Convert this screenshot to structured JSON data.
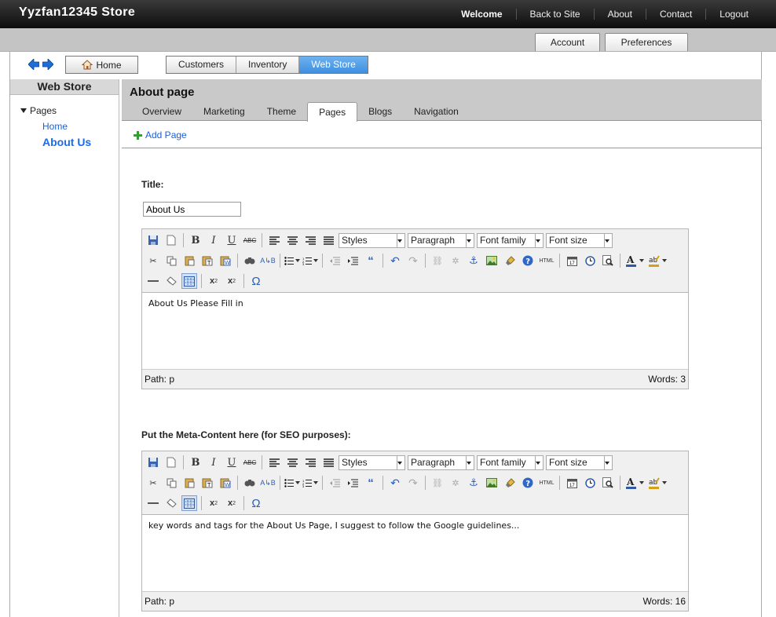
{
  "app": {
    "store_title": "Yyzfan12345 Store"
  },
  "topnav": {
    "welcome": "Welcome",
    "back_to_site": "Back to Site",
    "about": "About",
    "contact": "Contact",
    "logout": "Logout"
  },
  "strip": {
    "account": "Account",
    "preferences": "Preferences"
  },
  "toolbar": {
    "home": "Home",
    "tabs": [
      "Customers",
      "Inventory",
      "Web Store"
    ],
    "active_tab": "Web Store"
  },
  "sidebar": {
    "heading": "Web Store",
    "root": "Pages",
    "items": [
      "Home",
      "About Us"
    ],
    "selected": "About Us"
  },
  "main": {
    "heading": "About page",
    "tabs": [
      "Overview",
      "Marketing",
      "Theme",
      "Pages",
      "Blogs",
      "Navigation"
    ],
    "active_tab": "Pages",
    "add_page": "Add Page"
  },
  "form": {
    "title_label": "Title:",
    "title_value": "About Us",
    "meta_label": "Put the Meta-Content here (for SEO purposes):"
  },
  "editor_toolbar": {
    "styles": "Styles",
    "format": "Paragraph",
    "font_family": "Font family",
    "font_size": "Font size",
    "bold": "B",
    "italic": "I",
    "underline": "U",
    "strike": "ABC",
    "html": "HTML",
    "omega": "Ω"
  },
  "editors": [
    {
      "content": "About Us Please Fill in",
      "path": "Path: p",
      "words": "Words: 3"
    },
    {
      "content": "key words and tags for the About Us Page, I suggest to follow the Google guidelines...",
      "path": "Path: p",
      "words": "Words: 16"
    }
  ],
  "colors": {
    "active_tab": "#4a9ae6",
    "link": "#1d5fd6",
    "topbar": "#1a1a1a"
  }
}
